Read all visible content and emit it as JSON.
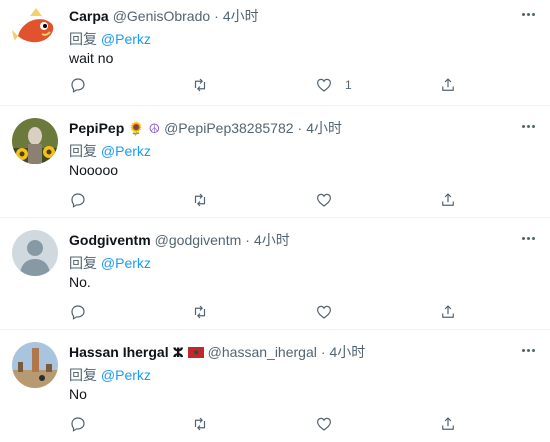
{
  "tweets": [
    {
      "name": "Carpa",
      "handle": "@GenisObrado",
      "dot": "·",
      "time": "4小时",
      "reply_prefix": "回复",
      "reply_to": "@Perkz",
      "text": "wait no",
      "likes": "1",
      "avatar": "magikarp-avatar",
      "badges": []
    },
    {
      "name": "PepiPep",
      "handle": "@PepiPep38285782",
      "dot": "·",
      "time": "4小时",
      "reply_prefix": "回复",
      "reply_to": "@Perkz",
      "text": "Nooooo",
      "likes": "",
      "avatar": "sunflower-avatar",
      "badges": [
        "🌻",
        "☮"
      ]
    },
    {
      "name": "Godgiventm",
      "handle": "@godgiventm",
      "dot": "·",
      "time": "4小时",
      "reply_prefix": "回复",
      "reply_to": "@Perkz",
      "text": "No.",
      "likes": "",
      "avatar": "default-avatar",
      "badges": []
    },
    {
      "name": "Hassan Ihergal",
      "handle": "@hassan_ihergal",
      "dot": "·",
      "time": "4小时",
      "reply_prefix": "回复",
      "reply_to": "@Perkz",
      "text": "No",
      "likes": "",
      "avatar": "landscape-avatar",
      "badges": [
        "ⵣ",
        "🇲🇦"
      ]
    }
  ],
  "colors": {
    "link": "#1d9bf0",
    "secondary": "#536471",
    "divider": "#eff3f4"
  }
}
